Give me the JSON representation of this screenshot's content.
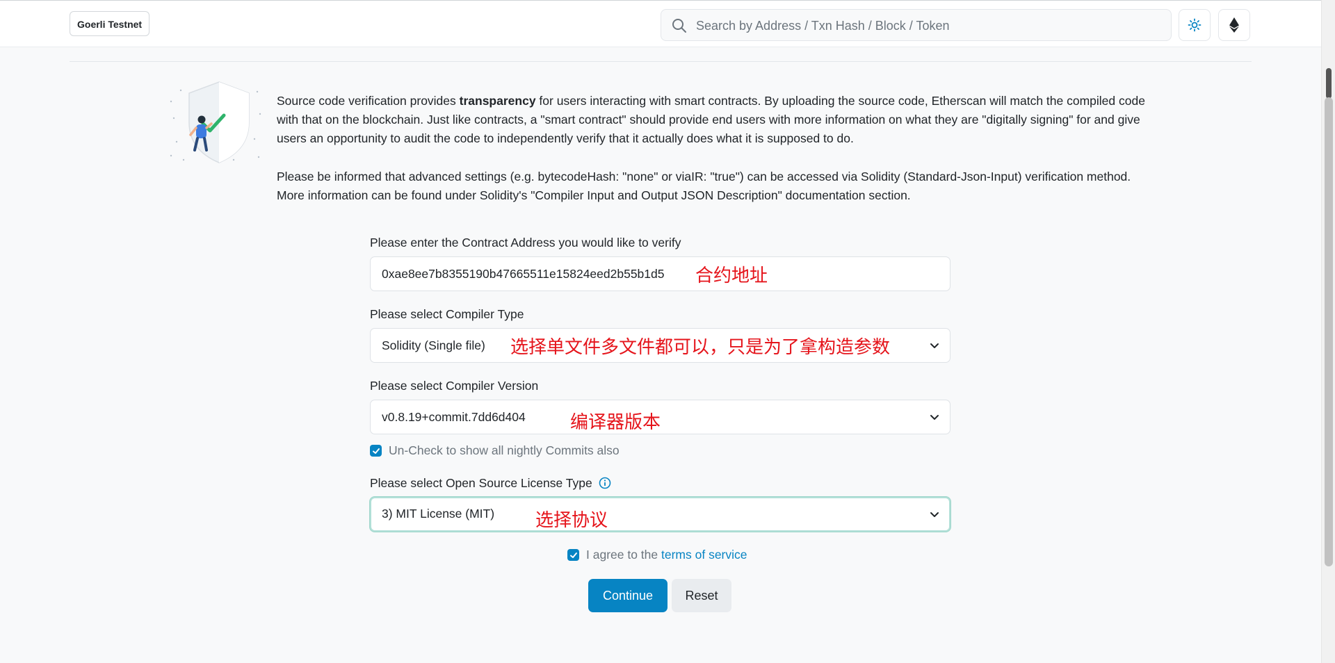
{
  "header": {
    "network_badge": "Goerli Testnet",
    "search_placeholder": "Search by Address / Txn Hash / Block / Token",
    "theme_icon": "sun-icon",
    "network_icon": "ethereum-icon"
  },
  "intro": {
    "p1_before": "Source code verification provides ",
    "p1_bold": "transparency",
    "p1_after": " for users interacting with smart contracts. By uploading the source code, Etherscan will match the compiled code with that on the blockchain. Just like contracts, a \"smart contract\" should provide end users with more information on what they are \"digitally signing\" for and give users an opportunity to audit the code to independently verify that it actually does what it is supposed to do.",
    "p2": "Please be informed that advanced settings (e.g. bytecodeHash: \"none\" or viaIR: \"true\") can be accessed via Solidity (Standard-Json-Input) verification method. More information can be found under Solidity's \"Compiler Input and Output JSON Description\" documentation section."
  },
  "form": {
    "address_label": "Please enter the Contract Address you would like to verify",
    "address_value": "0xae8ee7b8355190b47665511e15824eed2b55b1d5",
    "address_annotation": "合约地址",
    "compiler_type_label": "Please select Compiler Type",
    "compiler_type_value": "Solidity (Single file)",
    "compiler_type_annotation": "选择单文件多文件都可以，只是为了拿构造参数",
    "compiler_version_label": "Please select Compiler Version",
    "compiler_version_value": "v0.8.19+commit.7dd6d404",
    "compiler_version_annotation": "编译器版本",
    "nightly_checkbox_label": "Un-Check to show all nightly Commits also",
    "nightly_checked": true,
    "license_label": "Please select Open Source License Type",
    "license_value": "3) MIT License (MIT)",
    "license_annotation": "选择协议",
    "agree_prefix": "I agree to the ",
    "agree_link": "terms of service",
    "agree_checked": true
  },
  "buttons": {
    "continue": "Continue",
    "reset": "Reset"
  },
  "colors": {
    "primary": "#0784c3",
    "annotation": "#e5141b",
    "focus_border": "#b3e0d8"
  }
}
